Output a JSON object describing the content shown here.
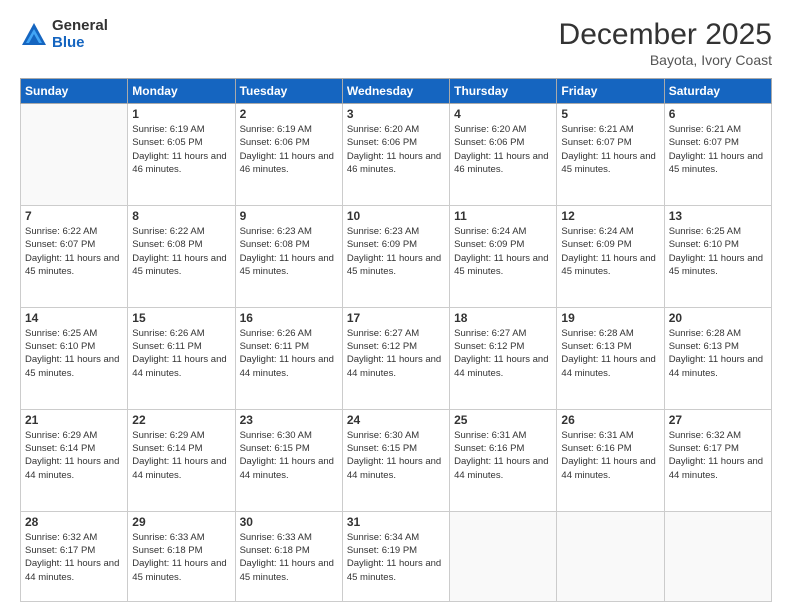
{
  "header": {
    "logo_general": "General",
    "logo_blue": "Blue",
    "month_title": "December 2025",
    "location": "Bayota, Ivory Coast"
  },
  "weekdays": [
    "Sunday",
    "Monday",
    "Tuesday",
    "Wednesday",
    "Thursday",
    "Friday",
    "Saturday"
  ],
  "weeks": [
    [
      {
        "day": "",
        "sunrise": "",
        "sunset": "",
        "daylight": ""
      },
      {
        "day": "1",
        "sunrise": "Sunrise: 6:19 AM",
        "sunset": "Sunset: 6:05 PM",
        "daylight": "Daylight: 11 hours and 46 minutes."
      },
      {
        "day": "2",
        "sunrise": "Sunrise: 6:19 AM",
        "sunset": "Sunset: 6:06 PM",
        "daylight": "Daylight: 11 hours and 46 minutes."
      },
      {
        "day": "3",
        "sunrise": "Sunrise: 6:20 AM",
        "sunset": "Sunset: 6:06 PM",
        "daylight": "Daylight: 11 hours and 46 minutes."
      },
      {
        "day": "4",
        "sunrise": "Sunrise: 6:20 AM",
        "sunset": "Sunset: 6:06 PM",
        "daylight": "Daylight: 11 hours and 46 minutes."
      },
      {
        "day": "5",
        "sunrise": "Sunrise: 6:21 AM",
        "sunset": "Sunset: 6:07 PM",
        "daylight": "Daylight: 11 hours and 45 minutes."
      },
      {
        "day": "6",
        "sunrise": "Sunrise: 6:21 AM",
        "sunset": "Sunset: 6:07 PM",
        "daylight": "Daylight: 11 hours and 45 minutes."
      }
    ],
    [
      {
        "day": "7",
        "sunrise": "Sunrise: 6:22 AM",
        "sunset": "Sunset: 6:07 PM",
        "daylight": "Daylight: 11 hours and 45 minutes."
      },
      {
        "day": "8",
        "sunrise": "Sunrise: 6:22 AM",
        "sunset": "Sunset: 6:08 PM",
        "daylight": "Daylight: 11 hours and 45 minutes."
      },
      {
        "day": "9",
        "sunrise": "Sunrise: 6:23 AM",
        "sunset": "Sunset: 6:08 PM",
        "daylight": "Daylight: 11 hours and 45 minutes."
      },
      {
        "day": "10",
        "sunrise": "Sunrise: 6:23 AM",
        "sunset": "Sunset: 6:09 PM",
        "daylight": "Daylight: 11 hours and 45 minutes."
      },
      {
        "day": "11",
        "sunrise": "Sunrise: 6:24 AM",
        "sunset": "Sunset: 6:09 PM",
        "daylight": "Daylight: 11 hours and 45 minutes."
      },
      {
        "day": "12",
        "sunrise": "Sunrise: 6:24 AM",
        "sunset": "Sunset: 6:09 PM",
        "daylight": "Daylight: 11 hours and 45 minutes."
      },
      {
        "day": "13",
        "sunrise": "Sunrise: 6:25 AM",
        "sunset": "Sunset: 6:10 PM",
        "daylight": "Daylight: 11 hours and 45 minutes."
      }
    ],
    [
      {
        "day": "14",
        "sunrise": "Sunrise: 6:25 AM",
        "sunset": "Sunset: 6:10 PM",
        "daylight": "Daylight: 11 hours and 45 minutes."
      },
      {
        "day": "15",
        "sunrise": "Sunrise: 6:26 AM",
        "sunset": "Sunset: 6:11 PM",
        "daylight": "Daylight: 11 hours and 44 minutes."
      },
      {
        "day": "16",
        "sunrise": "Sunrise: 6:26 AM",
        "sunset": "Sunset: 6:11 PM",
        "daylight": "Daylight: 11 hours and 44 minutes."
      },
      {
        "day": "17",
        "sunrise": "Sunrise: 6:27 AM",
        "sunset": "Sunset: 6:12 PM",
        "daylight": "Daylight: 11 hours and 44 minutes."
      },
      {
        "day": "18",
        "sunrise": "Sunrise: 6:27 AM",
        "sunset": "Sunset: 6:12 PM",
        "daylight": "Daylight: 11 hours and 44 minutes."
      },
      {
        "day": "19",
        "sunrise": "Sunrise: 6:28 AM",
        "sunset": "Sunset: 6:13 PM",
        "daylight": "Daylight: 11 hours and 44 minutes."
      },
      {
        "day": "20",
        "sunrise": "Sunrise: 6:28 AM",
        "sunset": "Sunset: 6:13 PM",
        "daylight": "Daylight: 11 hours and 44 minutes."
      }
    ],
    [
      {
        "day": "21",
        "sunrise": "Sunrise: 6:29 AM",
        "sunset": "Sunset: 6:14 PM",
        "daylight": "Daylight: 11 hours and 44 minutes."
      },
      {
        "day": "22",
        "sunrise": "Sunrise: 6:29 AM",
        "sunset": "Sunset: 6:14 PM",
        "daylight": "Daylight: 11 hours and 44 minutes."
      },
      {
        "day": "23",
        "sunrise": "Sunrise: 6:30 AM",
        "sunset": "Sunset: 6:15 PM",
        "daylight": "Daylight: 11 hours and 44 minutes."
      },
      {
        "day": "24",
        "sunrise": "Sunrise: 6:30 AM",
        "sunset": "Sunset: 6:15 PM",
        "daylight": "Daylight: 11 hours and 44 minutes."
      },
      {
        "day": "25",
        "sunrise": "Sunrise: 6:31 AM",
        "sunset": "Sunset: 6:16 PM",
        "daylight": "Daylight: 11 hours and 44 minutes."
      },
      {
        "day": "26",
        "sunrise": "Sunrise: 6:31 AM",
        "sunset": "Sunset: 6:16 PM",
        "daylight": "Daylight: 11 hours and 44 minutes."
      },
      {
        "day": "27",
        "sunrise": "Sunrise: 6:32 AM",
        "sunset": "Sunset: 6:17 PM",
        "daylight": "Daylight: 11 hours and 44 minutes."
      }
    ],
    [
      {
        "day": "28",
        "sunrise": "Sunrise: 6:32 AM",
        "sunset": "Sunset: 6:17 PM",
        "daylight": "Daylight: 11 hours and 44 minutes."
      },
      {
        "day": "29",
        "sunrise": "Sunrise: 6:33 AM",
        "sunset": "Sunset: 6:18 PM",
        "daylight": "Daylight: 11 hours and 45 minutes."
      },
      {
        "day": "30",
        "sunrise": "Sunrise: 6:33 AM",
        "sunset": "Sunset: 6:18 PM",
        "daylight": "Daylight: 11 hours and 45 minutes."
      },
      {
        "day": "31",
        "sunrise": "Sunrise: 6:34 AM",
        "sunset": "Sunset: 6:19 PM",
        "daylight": "Daylight: 11 hours and 45 minutes."
      },
      {
        "day": "",
        "sunrise": "",
        "sunset": "",
        "daylight": ""
      },
      {
        "day": "",
        "sunrise": "",
        "sunset": "",
        "daylight": ""
      },
      {
        "day": "",
        "sunrise": "",
        "sunset": "",
        "daylight": ""
      }
    ]
  ]
}
